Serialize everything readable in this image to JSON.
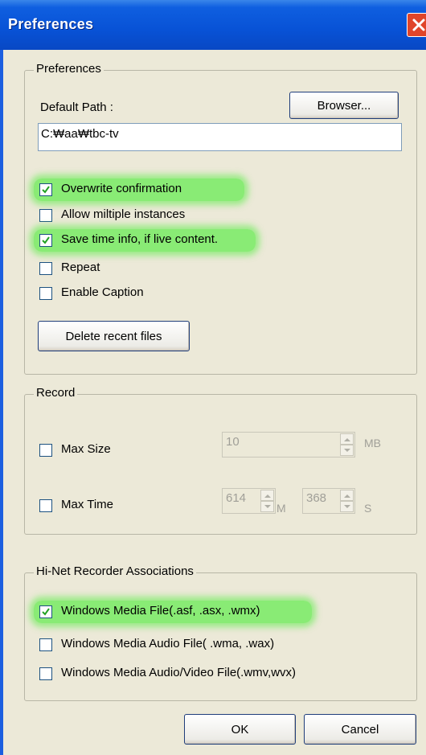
{
  "window": {
    "title": "Preferences"
  },
  "preferences": {
    "legend": "Preferences",
    "default_path_label": "Default Path :",
    "browse_label": "Browser...",
    "default_path_value": "C:₩aa₩tbc-tv",
    "options": [
      {
        "label": "Overwrite confirmation",
        "checked": true,
        "highlighted": true
      },
      {
        "label": "Allow miltiple instances",
        "checked": false,
        "highlighted": false
      },
      {
        "label": "Save time info, if live content.",
        "checked": true,
        "highlighted": true
      },
      {
        "label": "Repeat",
        "checked": false,
        "highlighted": false
      },
      {
        "label": "Enable Caption",
        "checked": false,
        "highlighted": false
      }
    ],
    "delete_recent_label": "Delete recent files"
  },
  "record": {
    "legend": "Record",
    "max_size_label": "Max Size",
    "max_size_value": "10",
    "max_size_unit": "MB",
    "max_time_label": "Max Time",
    "max_time_minutes": "614",
    "minutes_unit": "M",
    "max_time_seconds": "368",
    "seconds_unit": "S"
  },
  "associations": {
    "legend": "Hi-Net Recorder Associations",
    "items": [
      {
        "label": "Windows Media File(.asf, .asx, .wmx)",
        "checked": true,
        "highlighted": true
      },
      {
        "label": "Windows Media Audio File( .wma, .wax)",
        "checked": false,
        "highlighted": false
      },
      {
        "label": "Windows Media Audio/Video File(.wmv,wvx)",
        "checked": false,
        "highlighted": false
      }
    ]
  },
  "footer": {
    "ok_label": "OK",
    "cancel_label": "Cancel"
  },
  "colors": {
    "title_bar": "#0852d6",
    "highlight": "#78eb64",
    "close_button": "#e0452a"
  }
}
